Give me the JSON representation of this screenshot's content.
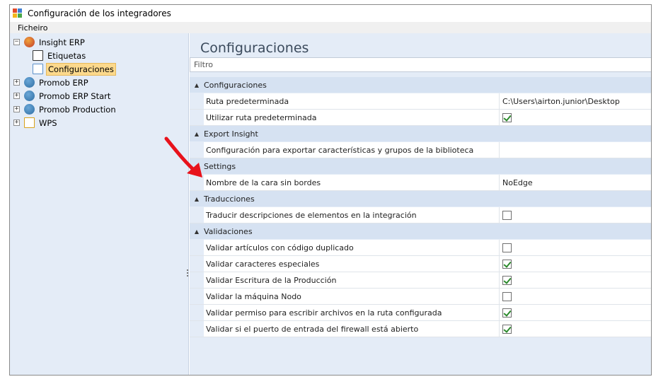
{
  "window": {
    "title": "Configuración de los integradores"
  },
  "menu": {
    "file_label": "Ficheiro"
  },
  "tree": {
    "items": [
      {
        "label": "Insight ERP",
        "expander": "⊟",
        "icon": "insight-erp-icon",
        "level": 0
      },
      {
        "label": "Etiquetas",
        "expander": "",
        "icon": "labels-icon",
        "level": 1
      },
      {
        "label": "Configuraciones",
        "expander": "",
        "icon": "configurations-icon",
        "level": 1,
        "selected": true
      },
      {
        "label": "Promob ERP",
        "expander": "⊞",
        "icon": "promob-globe-icon",
        "level": 0
      },
      {
        "label": "Promob ERP Start",
        "expander": "⊞",
        "icon": "promob-globe-icon",
        "level": 0
      },
      {
        "label": "Promob Production",
        "expander": "⊞",
        "icon": "promob-globe-icon",
        "level": 0
      },
      {
        "label": "WPS",
        "expander": "⊞",
        "icon": "wps-chart-icon",
        "level": 0
      }
    ]
  },
  "main": {
    "heading": "Configuraciones",
    "filter_placeholder": "Filtro",
    "groups": [
      {
        "label": "Configuraciones",
        "collapsible": true,
        "rows": [
          {
            "name": "Ruta predeterminada",
            "value": "C:\\Users\\airton.junior\\Desktop"
          },
          {
            "name": "Utilizar ruta predeterminada",
            "checkbox": true,
            "checked": true
          }
        ]
      },
      {
        "label": "Export Insight",
        "collapsible": true,
        "rows": [
          {
            "name": "Configuración para exportar características y grupos de la biblioteca",
            "value": ""
          }
        ]
      },
      {
        "label": "Settings",
        "collapsible": false,
        "rows": [
          {
            "name": "Nombre de la cara sin bordes",
            "value": "NoEdge"
          }
        ]
      },
      {
        "label": "Traducciones",
        "collapsible": true,
        "rows": [
          {
            "name": "Traducir descripciones de elementos en la integración",
            "checkbox": true,
            "checked": false
          }
        ]
      },
      {
        "label": "Validaciones",
        "collapsible": true,
        "rows": [
          {
            "name": "Validar artículos con código duplicado",
            "checkbox": true,
            "checked": false
          },
          {
            "name": "Validar caracteres especiales",
            "checkbox": true,
            "checked": true
          },
          {
            "name": "Validar Escritura de la Producción",
            "checkbox": true,
            "checked": true
          },
          {
            "name": "Validar la máquina Nodo",
            "checkbox": true,
            "checked": false
          },
          {
            "name": "Validar permiso para escribir archivos en la ruta configurada",
            "checkbox": true,
            "checked": true
          },
          {
            "name": "Validar si el puerto de entrada del firewall está abierto",
            "checkbox": true,
            "checked": true
          }
        ]
      }
    ]
  },
  "colors": {
    "panel_bg": "#e4ecf7",
    "group_bg": "#d6e2f2",
    "selection": "#fcd98c",
    "annotation_arrow": "#e8121b",
    "check": "#2c8a2c"
  }
}
